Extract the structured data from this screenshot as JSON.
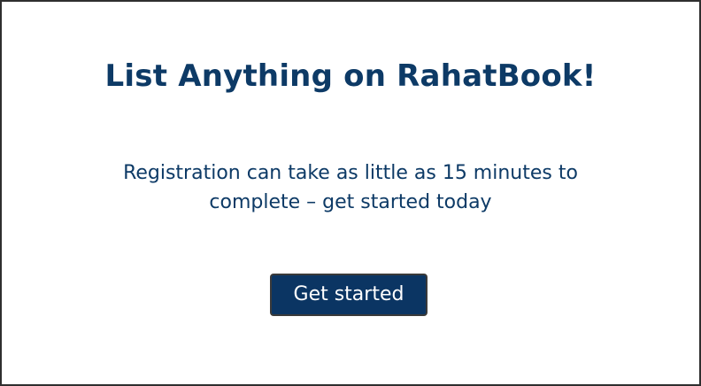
{
  "hero": {
    "title": "List Anything on RahatBook!",
    "description": "Registration can take as little as 15 minutes to complete – get started today",
    "cta_label": "Get started"
  },
  "colors": {
    "text": "#0d3a66",
    "button_bg": "#0b3563",
    "button_text": "#ffffff",
    "border": "#2f2f2f"
  }
}
